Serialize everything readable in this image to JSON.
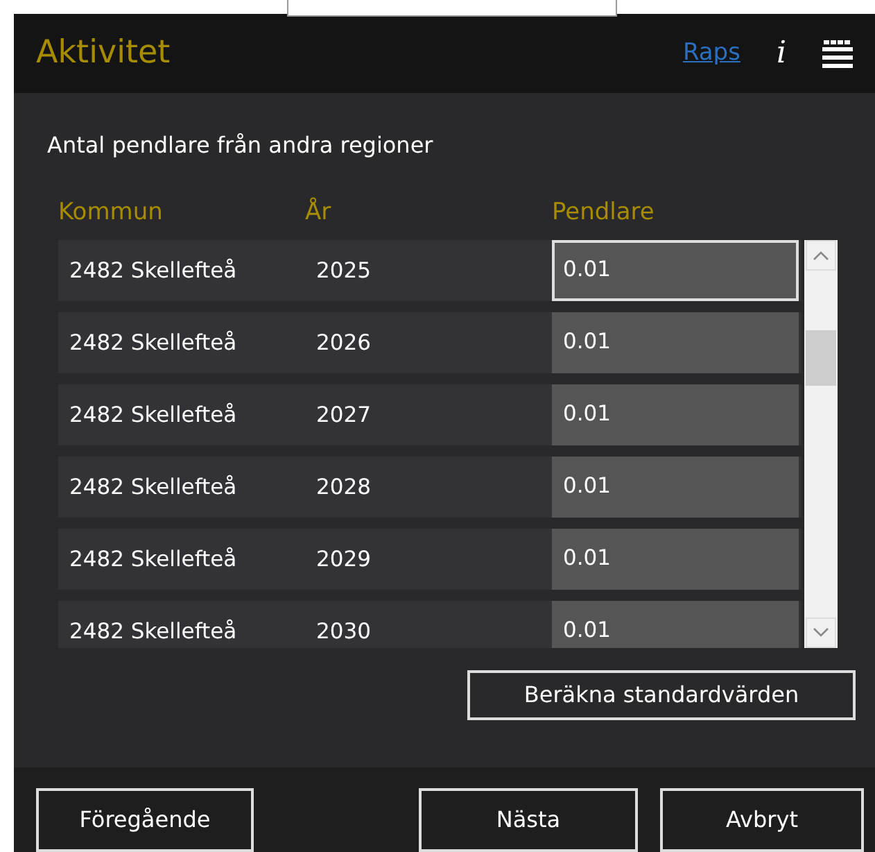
{
  "header": {
    "title": "Aktivitet",
    "link": "Raps",
    "info_glyph": "i"
  },
  "section_title": "Antal pendlare från andra regioner",
  "table": {
    "columns": [
      "Kommun",
      "År",
      "Pendlare"
    ],
    "rows": [
      {
        "kommun": "2482 Skellefteå",
        "year": "2025",
        "value": "0.01",
        "focused": true
      },
      {
        "kommun": "2482 Skellefteå",
        "year": "2026",
        "value": "0.01",
        "focused": false
      },
      {
        "kommun": "2482 Skellefteå",
        "year": "2027",
        "value": "0.01",
        "focused": false
      },
      {
        "kommun": "2482 Skellefteå",
        "year": "2028",
        "value": "0.01",
        "focused": false
      },
      {
        "kommun": "2482 Skellefteå",
        "year": "2029",
        "value": "0.01",
        "focused": false
      },
      {
        "kommun": "2482 Skellefteå",
        "year": "2030",
        "value": "0.01",
        "focused": false
      }
    ]
  },
  "compute_button": "Beräkna standardvärden",
  "footer_buttons": [
    "Föregående",
    "Nästa",
    "Avbryt"
  ]
}
